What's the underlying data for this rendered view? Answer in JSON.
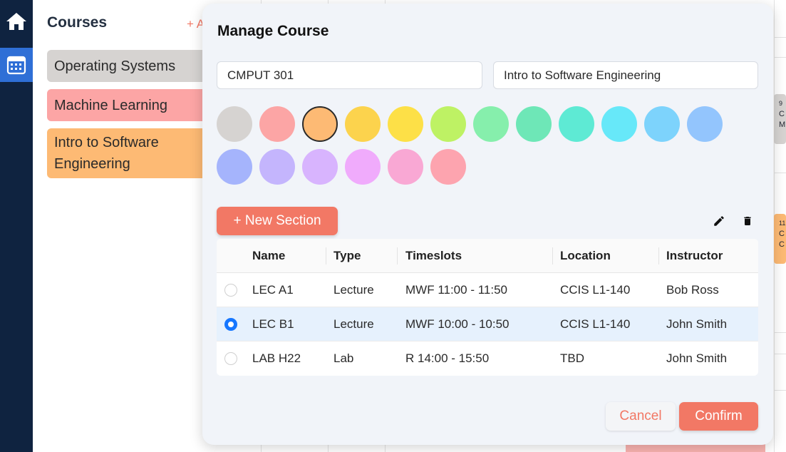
{
  "rail": {
    "items": [
      {
        "icon": "home-icon"
      },
      {
        "icon": "calendar-icon",
        "active": true
      }
    ]
  },
  "courses": {
    "title": "Courses",
    "add_label": "+ A",
    "items": [
      {
        "name": "Operating Systems",
        "color": "#d6d3d1"
      },
      {
        "name": "Machine Learning",
        "color": "#fca5a5"
      },
      {
        "name": "Intro to Software Engineering",
        "color": "#fdba74"
      }
    ]
  },
  "calendar": {
    "events": [
      {
        "lines": [
          "9",
          "C",
          "M"
        ],
        "color": "#d6d3d1"
      },
      {
        "lines": [
          "11",
          "C",
          "C"
        ],
        "color": "#fdba74"
      }
    ]
  },
  "modal": {
    "title": "Manage Course",
    "course_code": "CMPUT 301",
    "course_name": "Intro to Software Engineering",
    "colors": [
      "#d6d3d1",
      "#fca5a5",
      "#fdba74",
      "#fcd34d",
      "#fde047",
      "#bef264",
      "#86efac",
      "#6ee7b7",
      "#5eead4",
      "#67e8f9",
      "#7dd3fc",
      "#93c5fd",
      "#a5b4fc",
      "#c4b5fd",
      "#d8b4fe",
      "#f0abfc",
      "#f9a8d4",
      "#fda4af"
    ],
    "selected_color_index": 2,
    "new_section_label": "+ New Section",
    "tools": {
      "edit_icon": "pencil-icon",
      "delete_icon": "trash-icon"
    },
    "table": {
      "headers": [
        "Name",
        "Type",
        "Timeslots",
        "Location",
        "Instructor"
      ],
      "rows": [
        {
          "name": "LEC A1",
          "type": "Lecture",
          "timeslots": "MWF 11:00 - 11:50",
          "location": "CCIS L1-140",
          "instructor": "Bob Ross",
          "selected": false
        },
        {
          "name": "LEC B1",
          "type": "Lecture",
          "timeslots": "MWF 10:00 - 10:50",
          "location": "CCIS L1-140",
          "instructor": "John Smith",
          "selected": true
        },
        {
          "name": "LAB H22",
          "type": "Lab",
          "timeslots": "R 14:00 - 15:50",
          "location": "TBD",
          "instructor": "John Smith",
          "selected": false
        }
      ]
    },
    "cancel_label": "Cancel",
    "confirm_label": "Confirm"
  }
}
